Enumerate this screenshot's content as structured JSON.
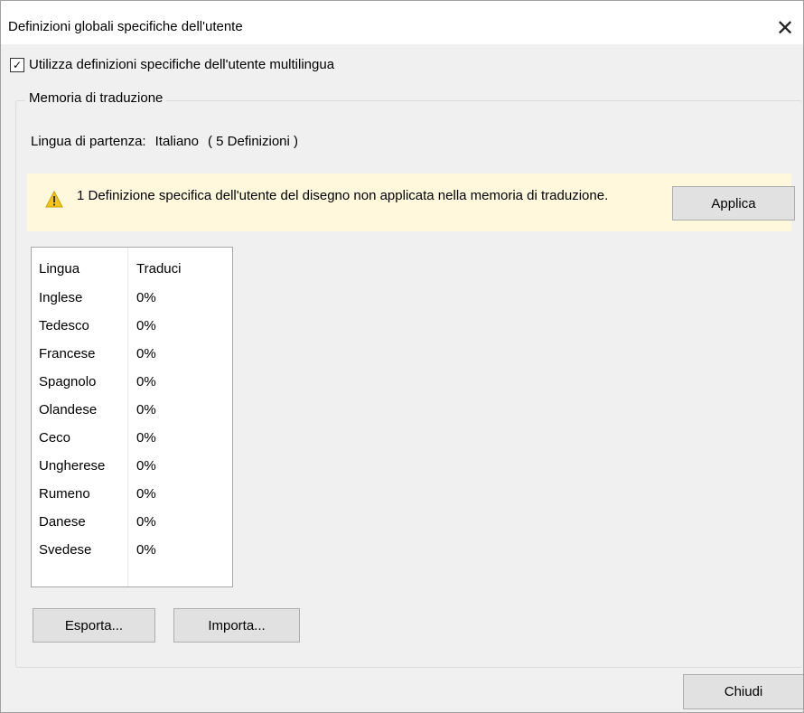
{
  "window": {
    "title": "Definizioni globali specifiche dell'utente",
    "close_glyph": "✕"
  },
  "checkbox": {
    "label": "Utilizza definizioni specifiche dell'utente multilingua",
    "checked": true,
    "mark": "✓"
  },
  "group": {
    "label": "Memoria di traduzione",
    "source_label": "Lingua di partenza:",
    "source_value": "Italiano",
    "source_count": "( 5 Definizioni )"
  },
  "warning": {
    "icon": "warning-triangle-icon",
    "text": "1 Definizione specifica dell'utente del disegno non applicata nella memoria di traduzione.",
    "apply_label": "Applica"
  },
  "table": {
    "headers": [
      "Lingua",
      "Traduci"
    ],
    "rows": [
      {
        "lang": "Inglese",
        "pct": "0%"
      },
      {
        "lang": "Tedesco",
        "pct": "0%"
      },
      {
        "lang": "Francese",
        "pct": "0%"
      },
      {
        "lang": "Spagnolo",
        "pct": "0%"
      },
      {
        "lang": "Olandese",
        "pct": "0%"
      },
      {
        "lang": "Ceco",
        "pct": "0%"
      },
      {
        "lang": "Ungherese",
        "pct": "0%"
      },
      {
        "lang": "Rumeno",
        "pct": "0%"
      },
      {
        "lang": "Danese",
        "pct": "0%"
      },
      {
        "lang": "Svedese",
        "pct": "0%"
      }
    ]
  },
  "buttons": {
    "export": "Esporta...",
    "import": "Importa...",
    "close": "Chiudi"
  },
  "colors": {
    "warning_bg": "#fff8dc",
    "warning_icon": "#f5c518",
    "button_bg": "#e1e1e1"
  }
}
